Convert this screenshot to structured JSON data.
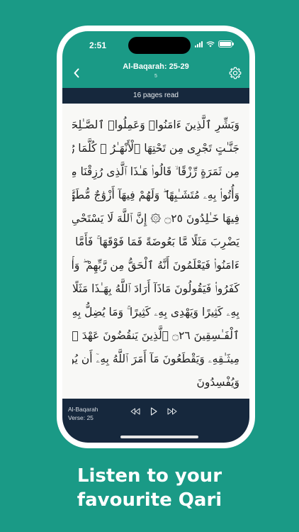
{
  "status_bar": {
    "time": "2:51"
  },
  "header": {
    "title": "Al-Baqarah: 25-29",
    "subtitle": "5",
    "back_icon": "chevron-left-icon",
    "settings_icon": "gear-icon"
  },
  "progress": {
    "text": "16 pages read"
  },
  "reader": {
    "lines": [
      "وَبَشِّرِ ٱلَّذِينَ ءَامَنُوا۟ وَعَمِلُوا۟ ٱلصَّـٰلِحَـٰتِ أَنَّ لَهُمْ",
      "جَنَّـٰتٍ تَجْرِى مِن تَحْتِهَا ٱلْأَنْهَـٰرُ ۖ كُلَّمَا رُزِقُوا۟ مِنْهَا",
      "مِن ثَمَرَةٍ رِّزْقًا ۙ قَالُوا۟ هَـٰذَا ٱلَّذِى رُزِقْنَا مِن قَبْلُ ۖ",
      "وَأُتُوا۟ بِهِۦ مُتَشَـٰبِهًا ۖ وَلَهُمْ فِيهَآ أَزْوَٰجٌ مُّطَهَّرَةٌ ۖ وَهُمْ",
      "فِيهَا خَـٰلِدُونَ ۝٢٥ ۞ إِنَّ ٱللَّهَ لَا يَسْتَحْىِۦٓ أَن",
      "يَضْرِبَ مَثَلًا مَّا بَعُوضَةً فَمَا فَوْقَهَا ۚ فَأَمَّا ٱلَّذِينَ",
      "ءَامَنُوا۟ فَيَعْلَمُونَ أَنَّهُ ٱلْحَقُّ مِن رَّبِّهِمْ ۖ وَأَمَّا ٱلَّذِينَ",
      "كَفَرُوا۟ فَيَقُولُونَ مَاذَآ أَرَادَ ٱللَّهُ بِهَـٰذَا مَثَلًا ۘ يُضِلُّ",
      "بِهِۦ كَثِيرًا وَيَهْدِى بِهِۦ كَثِيرًا ۚ وَمَا يُضِلُّ بِهِۦٓ إِلَّا",
      "ٱلْفَـٰسِقِينَ ۝٢٦ ٱلَّذِينَ يَنقُضُونَ عَهْدَ ٱللَّهِ مِنۢ بَعْدِ",
      "مِيثَـٰقِهِۦ وَيَقْطَعُونَ مَآ أَمَرَ ٱللَّهُ بِهِۦٓ أَن يُوصَلَ",
      "وَيُفْسِدُونَ"
    ]
  },
  "player": {
    "surah": "Al-Baqarah",
    "verse": "Verse: 25",
    "controls": [
      "rewind-icon",
      "play-icon",
      "fast-forward-icon"
    ]
  },
  "caption": {
    "line1": "Listen to your",
    "line2": "favourite Qari"
  },
  "colors": {
    "background": "#1a9a86",
    "header": "#1a9a86",
    "dark_bar": "#16283d",
    "page": "#f8f8f6"
  }
}
